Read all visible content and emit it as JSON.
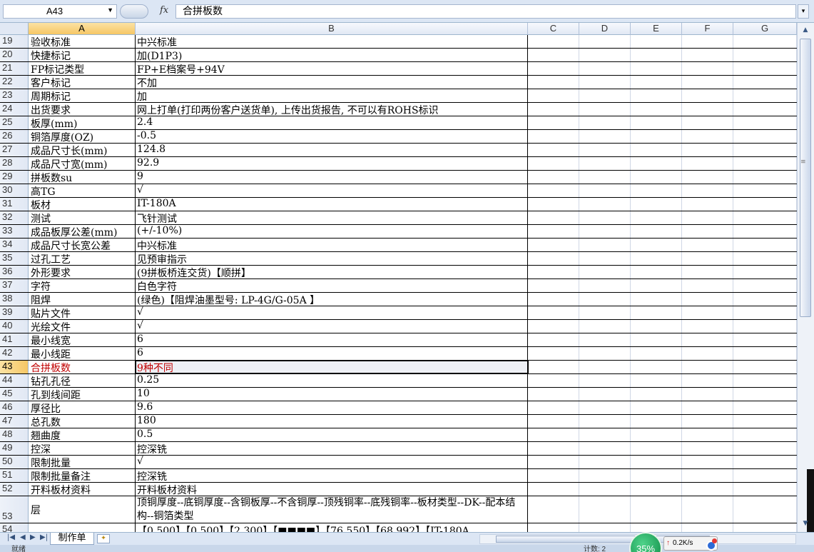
{
  "formula_bar": {
    "name_box": "A43",
    "fx_label": "fx",
    "formula": "合拼板数"
  },
  "columns": [
    "A",
    "B",
    "C",
    "D",
    "E",
    "F",
    "G"
  ],
  "selected_column": "A",
  "rows": [
    {
      "num": "19",
      "a": "验收标准",
      "b": "中兴标准"
    },
    {
      "num": "20",
      "a": "快捷标记",
      "b": "加(D1P3)"
    },
    {
      "num": "21",
      "a": "FP标记类型",
      "b": "FP+E档案号+94V"
    },
    {
      "num": "22",
      "a": "客户标记",
      "b": "不加"
    },
    {
      "num": "23",
      "a": "周期标记",
      "b": "加"
    },
    {
      "num": "24",
      "a": "出货要求",
      "b": "网上打单(打印两份客户送货单), 上传出货报告, 不可以有ROHS标识"
    },
    {
      "num": "25",
      "a": "板厚(mm)",
      "b": "2.4"
    },
    {
      "num": "26",
      "a": "铜箔厚度(OZ)",
      "b": "-0.5"
    },
    {
      "num": "27",
      "a": "成品尺寸长(mm)",
      "b": "124.8"
    },
    {
      "num": "28",
      "a": "成品尺寸宽(mm)",
      "b": "92.9"
    },
    {
      "num": "29",
      "a": "拼板数su",
      "b": "9"
    },
    {
      "num": "30",
      "a": "高TG",
      "b": "√"
    },
    {
      "num": "31",
      "a": "板材",
      "b": "IT-180A"
    },
    {
      "num": "32",
      "a": "测试",
      "b": "飞针测试"
    },
    {
      "num": "33",
      "a": "成品板厚公差(mm)",
      "b": "(+/-10%)"
    },
    {
      "num": "34",
      "a": "成品尺寸长宽公差",
      "b": "中兴标准"
    },
    {
      "num": "35",
      "a": "过孔工艺",
      "b": "见预审指示"
    },
    {
      "num": "36",
      "a": "外形要求",
      "b": "(9拼板桥连交货)【顺拼】"
    },
    {
      "num": "37",
      "a": "字符",
      "b": "白色字符"
    },
    {
      "num": "38",
      "a": "阻焊",
      "b": "(绿色)【阻焊油墨型号: LP-4G/G-05A 】"
    },
    {
      "num": "39",
      "a": "贴片文件",
      "b": "√"
    },
    {
      "num": "40",
      "a": "光绘文件",
      "b": "√"
    },
    {
      "num": "41",
      "a": "最小线宽",
      "b": "6"
    },
    {
      "num": "42",
      "a": "最小线距",
      "b": "6"
    },
    {
      "num": "43",
      "a": "合拼板数",
      "b": "9种不同",
      "active": true
    },
    {
      "num": "44",
      "a": "钻孔孔径",
      "b": "0.25"
    },
    {
      "num": "45",
      "a": "孔到线间距",
      "b": "10"
    },
    {
      "num": "46",
      "a": "厚径比",
      "b": "9.6"
    },
    {
      "num": "47",
      "a": "总孔数",
      "b": "180"
    },
    {
      "num": "48",
      "a": "翘曲度",
      "b": "0.5"
    },
    {
      "num": "49",
      "a": "控深",
      "b": "控深铣"
    },
    {
      "num": "50",
      "a": "限制批量",
      "b": "√"
    },
    {
      "num": "51",
      "a": "限制批量备注",
      "b": "控深铣"
    },
    {
      "num": "52",
      "a": "开料板材资料",
      "b": "开料板材资料"
    },
    {
      "num": "53",
      "a": "层",
      "b": "顶铜厚度--底铜厚度--含铜板厚--不含铜厚--顶残铜率--底残铜率--板材类型--DK--配本结构--铜箔类型",
      "tall": true
    },
    {
      "num": "54",
      "a": "",
      "b": "【0.500】【0.500】【2.300】【■■■■】【76.550】【68.992】【IT-180A"
    }
  ],
  "sheet_tabs": [
    "制作单"
  ],
  "status": {
    "left": "就绪",
    "count": "计数: 2"
  },
  "net_widget": {
    "percent": "35%",
    "speed": "0.2K/s",
    "arrow": "↑"
  }
}
